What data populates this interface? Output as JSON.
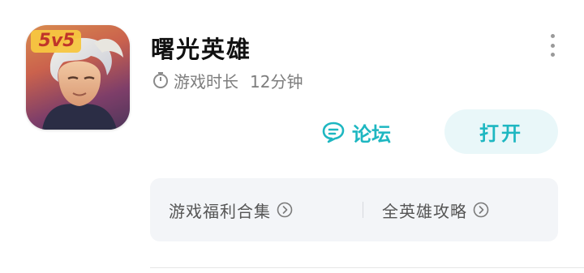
{
  "app": {
    "title": "曙光英雄",
    "icon_badge": "5v5",
    "icon_name": "game-hero-icon",
    "playtime_label": "游戏时长",
    "playtime_value": "12分钟"
  },
  "actions": {
    "forum_label": "论坛",
    "open_label": "打开"
  },
  "links": [
    {
      "label": "游戏福利合集"
    },
    {
      "label": "全英雄攻略"
    }
  ],
  "colors": {
    "accent": "#1eb7c1",
    "open_button_bg": "#e9f7f9",
    "panel_bg": "#f3f5f8"
  }
}
